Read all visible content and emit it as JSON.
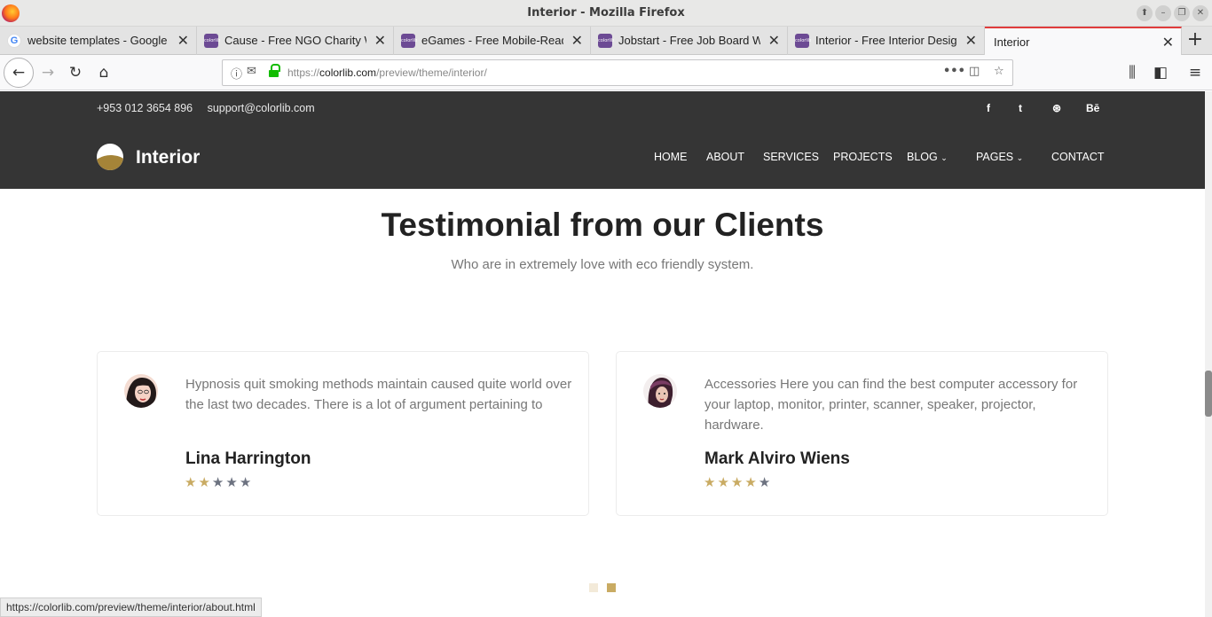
{
  "window": {
    "title": "Interior - Mozilla Firefox"
  },
  "tabs": [
    {
      "label": "website templates - Google S",
      "favicon": "google-icon"
    },
    {
      "label": "Cause - Free NGO Charity We",
      "favicon": "colorlib-icon"
    },
    {
      "label": "eGames - Free Mobile-Ready",
      "favicon": "colorlib-icon"
    },
    {
      "label": "Jobstart - Free Job Board Web",
      "favicon": "colorlib-icon"
    },
    {
      "label": "Interior - Free Interior Design",
      "favicon": "colorlib-icon"
    },
    {
      "label": "Interior",
      "favicon": ""
    }
  ],
  "urlbar": {
    "prefix": "https://",
    "domain": "colorlib.com",
    "path": "/preview/theme/interior/"
  },
  "site": {
    "phone": "+953 012 3654 896",
    "email": "support@colorlib.com",
    "social": [
      "f",
      "t",
      "dribbble-icon",
      "Bē"
    ],
    "brand": "Interior",
    "menu": [
      "HOME",
      "ABOUT",
      "SERVICES",
      "PROJECTS",
      "BLOG",
      "PAGES",
      "CONTACT"
    ],
    "accent": "#c9ab63"
  },
  "section": {
    "title": "Testimonial from our Clients",
    "subtitle": "Who are in extremely love with eco friendly system."
  },
  "testimonials": [
    {
      "quote": "Hypnosis quit smoking methods maintain caused quite world over the last two decades. There is a lot of argument pertaining to",
      "name": "Lina Harrington",
      "rating": 2,
      "max_rating": 5
    },
    {
      "quote": "Accessories Here you can find the best computer accessory for your laptop, monitor, printer, scanner, speaker, projector, hardware.",
      "name": "Mark Alviro Wiens",
      "rating": 4,
      "max_rating": 5
    }
  ],
  "carousel": {
    "slides": 2,
    "active": 2
  },
  "status": "https://colorlib.com/preview/theme/interior/about.html"
}
